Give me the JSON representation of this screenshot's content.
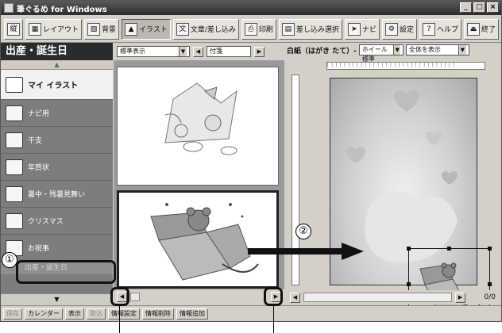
{
  "window": {
    "title": "筆ぐるめ for Windows",
    "controls": [
      "_",
      "□",
      "×"
    ]
  },
  "toolbar": {
    "items": [
      {
        "label": "",
        "icon": "tategaki-icon"
      },
      {
        "label": "レイアウト",
        "icon": "layout-icon"
      },
      {
        "label": "背景",
        "icon": "background-icon"
      },
      {
        "label": "イラスト",
        "icon": "illust-icon",
        "active": true
      },
      {
        "label": "文章/差し込み",
        "icon": "text-icon"
      },
      {
        "label": "印刷",
        "icon": "print-icon"
      },
      {
        "label": "差し込み選択",
        "icon": "merge-icon"
      },
      {
        "label": "ナビ",
        "icon": "navi-icon"
      },
      {
        "label": "設定",
        "icon": "settings-icon"
      },
      {
        "label": "ヘルプ",
        "icon": "help-icon"
      },
      {
        "label": "終了",
        "icon": "exit-icon"
      }
    ]
  },
  "left_panel": {
    "title": "出産・誕生日",
    "items": [
      {
        "label": "マイ イラスト",
        "icon": "folder-icon"
      },
      {
        "label": "ナビ用",
        "icon": "folder-icon"
      },
      {
        "label": "干支",
        "icon": "folder-icon"
      },
      {
        "label": "年賀状",
        "icon": "folder-icon"
      },
      {
        "label": "暑中・残暑見舞い",
        "icon": "folder-icon"
      },
      {
        "label": "クリスマス",
        "icon": "folder-icon"
      },
      {
        "label": "お祝事",
        "icon": "folder-icon"
      }
    ],
    "sub_items": [
      "出産・誕生日"
    ],
    "scroll_down": "▼",
    "scroll_up": "▲"
  },
  "middle_panel": {
    "view_select": "標準表示",
    "tag_select": "付箋"
  },
  "right_panel": {
    "paper_label": "白紙（はがき たて）- ",
    "view_mode": "ホイール標準",
    "zoom": "全体を表示",
    "page_count": "0/0"
  },
  "status_bar": {
    "items": [
      "保存",
      "カレンダー",
      "表示",
      "取込",
      "情報設定",
      "情報削除",
      "情報追加"
    ]
  },
  "callouts": [
    "①",
    "②"
  ]
}
